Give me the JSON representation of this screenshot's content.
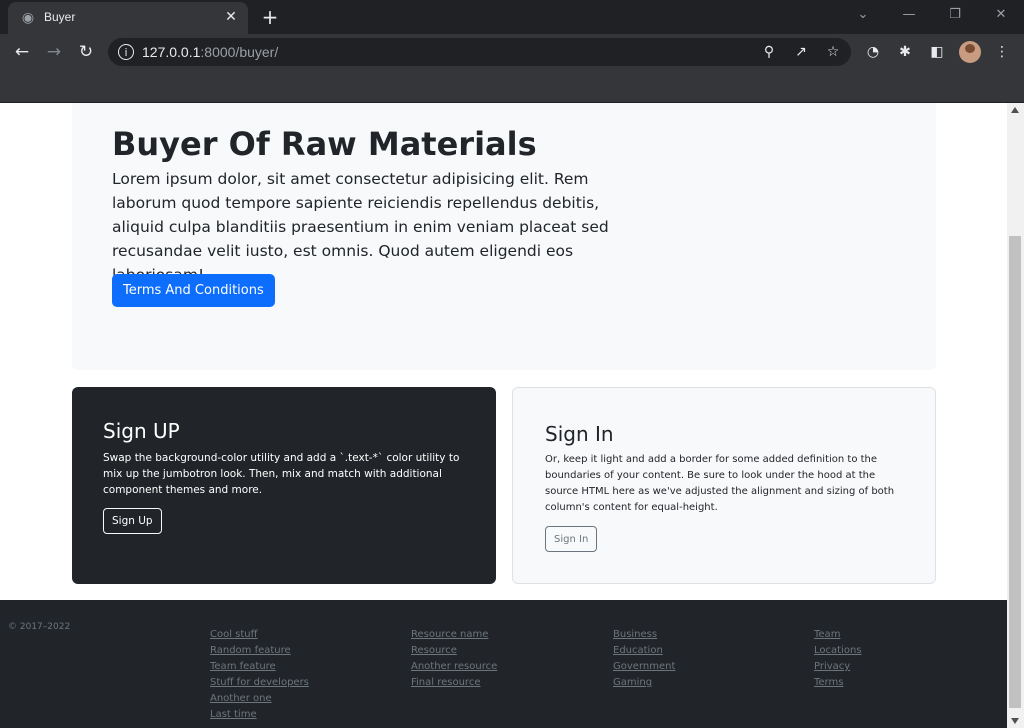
{
  "browser": {
    "tab_title": "Buyer",
    "url_host": "127.0.0.1",
    "url_rest": ":8000/buyer/"
  },
  "hero": {
    "title": "Buyer Of Raw Materials",
    "text": "Lorem ipsum dolor, sit amet consectetur adipisicing elit. Rem laborum quod tempore sapiente reiciendis repellendus debitis, aliquid culpa blanditiis praesentium in enim veniam placeat sed recusandae velit iusto, est omnis. Quod autem eligendi eos laboriosam!",
    "button_label": "Terms And Conditions"
  },
  "signup": {
    "title": "Sign UP",
    "text": "Swap the background-color utility and add a `.text-*` color utility to mix up the jumbotron look. Then, mix and match with additional component themes and more.",
    "button_label": "Sign Up"
  },
  "signin": {
    "title": "Sign In",
    "text": "Or, keep it light and add a border for some added definition to the boundaries of your content. Be sure to look under the hood at the source HTML here as we've adjusted the alignment and sizing of both column's content for equal-height.",
    "button_label": "Sign In"
  },
  "footer": {
    "copyright": "© 2017–2022",
    "columns": [
      [
        "Cool stuff",
        "Random feature",
        "Team feature",
        "Stuff for developers",
        "Another one",
        "Last time"
      ],
      [
        "Resource name",
        "Resource",
        "Another resource",
        "Final resource"
      ],
      [
        "Business",
        "Education",
        "Government",
        "Gaming"
      ],
      [
        "Team",
        "Locations",
        "Privacy",
        "Terms"
      ]
    ]
  }
}
